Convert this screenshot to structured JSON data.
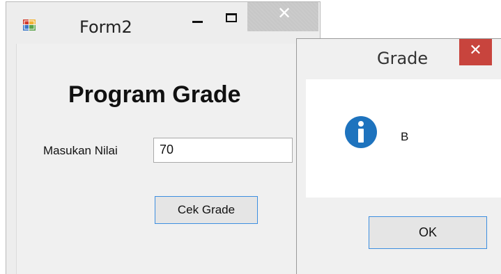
{
  "form2": {
    "title": "Form2",
    "heading": "Program Grade",
    "input_label": "Masukan Nilai",
    "input_value": "70",
    "check_button": "Cek Grade",
    "icons": {
      "app": "form-app-icon",
      "minimize": "minimize-icon",
      "maximize": "maximize-icon",
      "close": "close-icon"
    }
  },
  "messagebox": {
    "title": "Grade",
    "message": "B",
    "ok_button": "OK",
    "icons": {
      "info": "info-icon",
      "close": "close-icon"
    },
    "colors": {
      "close_bg": "#c8443d",
      "info_blue": "#1e73be",
      "focus_border": "#3c8ee0"
    }
  }
}
